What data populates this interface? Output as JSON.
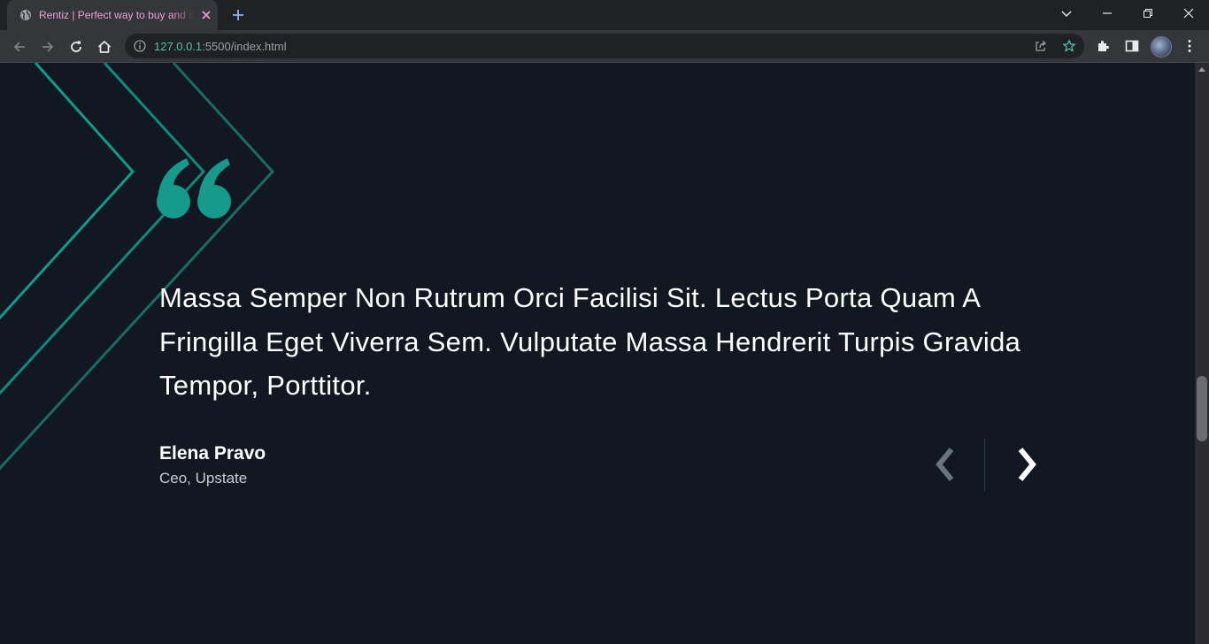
{
  "browser": {
    "tab_title": "Rentiz | Perfect way to buy and sell",
    "url_host": "127.0.0.1",
    "url_rest": ":5500/index.html"
  },
  "testimonial": {
    "quote": "Massa Semper Non Rutrum Orci Facilisi Sit. Lectus Porta Quam A Fringilla Eget Viverra Sem. Vulputate Massa Hendrerit Turpis Gravida Tempor, Porttitor.",
    "author_name": "Elena Pravo",
    "author_role": "Ceo, Upstate"
  },
  "colors": {
    "accent": "#159a8c",
    "background": "#121822",
    "arrow_prev": "#6b7280",
    "arrow_next": "#ffffff"
  },
  "icons": {
    "favicon": "globe-icon",
    "tab_close": "close-icon",
    "new_tab": "plus-icon",
    "back": "arrow-left-icon",
    "forward": "arrow-right-icon",
    "reload": "reload-icon",
    "home": "home-icon",
    "site_info": "info-icon",
    "share": "share-icon",
    "bookmark": "star-icon",
    "extensions": "puzzle-icon",
    "side_panel": "side-panel-icon",
    "menu": "kebab-menu-icon",
    "prev": "chevron-left-icon",
    "next": "chevron-right-icon",
    "quote": "quote-icon"
  }
}
